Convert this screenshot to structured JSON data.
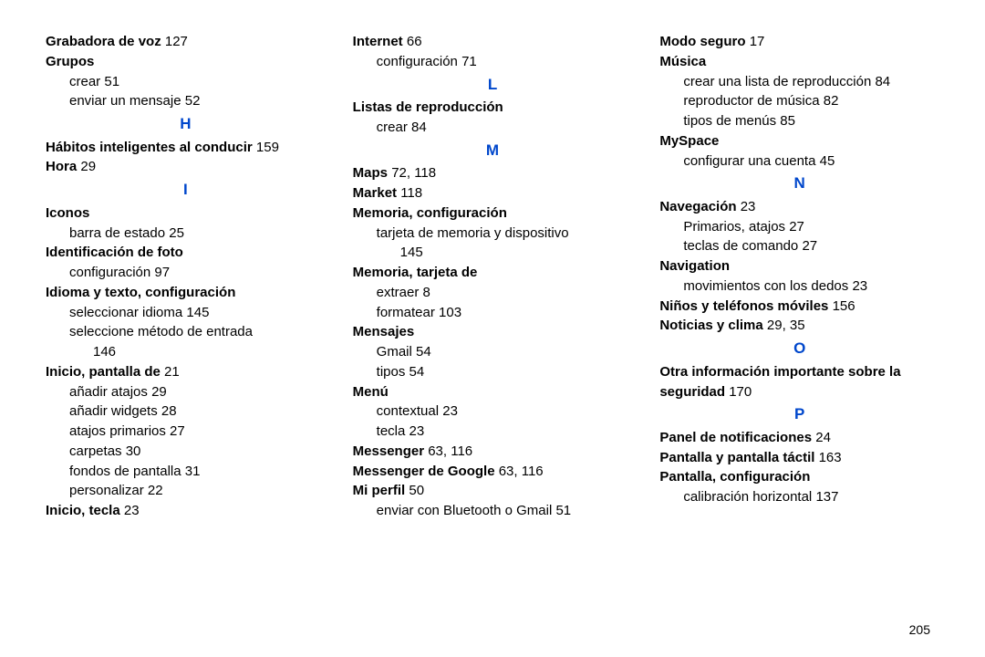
{
  "pageNumber": "205",
  "col1": {
    "grabadora": "Grabadora de voz",
    "grabadora_pg": "127",
    "grupos": "Grupos",
    "grupos_crear": "crear",
    "grupos_crear_pg": "51",
    "grupos_enviar": "enviar un mensaje",
    "grupos_enviar_pg": "52",
    "letter_H": "H",
    "habitos": "Hábitos inteligentes al conducir",
    "habitos_pg": "159",
    "hora": "Hora",
    "hora_pg": "29",
    "letter_I": "I",
    "iconos": "Iconos",
    "iconos_barra": "barra de estado",
    "iconos_barra_pg": "25",
    "ident_foto": "Identificación de foto",
    "ident_foto_cfg": "configuración",
    "ident_foto_cfg_pg": "97",
    "idioma": "Idioma y texto, configuración",
    "idioma_sel": "seleccionar idioma",
    "idioma_sel_pg": "145",
    "idioma_metodo": "seleccione método de entrada",
    "idioma_metodo_pg": "146",
    "inicio_pant": "Inicio, pantalla de",
    "inicio_pant_pg": "21",
    "inicio_atajos": "añadir atajos",
    "inicio_atajos_pg": "29",
    "inicio_widgets": "añadir widgets",
    "inicio_widgets_pg": "28",
    "inicio_prim": "atajos primarios",
    "inicio_prim_pg": "27",
    "inicio_carp": "carpetas",
    "inicio_carp_pg": "30",
    "inicio_fondos": "fondos de pantalla",
    "inicio_fondos_pg": "31",
    "inicio_pers": "personalizar",
    "inicio_pers_pg": "22",
    "inicio_tecla": "Inicio, tecla",
    "inicio_tecla_pg": "23"
  },
  "col2": {
    "internet": "Internet",
    "internet_pg": "66",
    "internet_cfg": "configuración",
    "internet_cfg_pg": "71",
    "letter_L": "L",
    "listas": "Listas de reproducción",
    "listas_crear": "crear",
    "listas_crear_pg": "84",
    "letter_M": "M",
    "maps": "Maps",
    "maps_pg": "72, 118",
    "market": "Market",
    "market_pg": "118",
    "mem_cfg": "Memoria, configuración",
    "mem_cfg_tarj": "tarjeta de memoria y dispositivo",
    "mem_cfg_tarj_pg": "145",
    "mem_tarj": "Memoria, tarjeta de",
    "mem_extraer": "extraer",
    "mem_extraer_pg": "8",
    "mem_format": "formatear",
    "mem_format_pg": "103",
    "mensajes": "Mensajes",
    "mensajes_gmail": "Gmail",
    "mensajes_gmail_pg": "54",
    "mensajes_tipos": "tipos",
    "mensajes_tipos_pg": "54",
    "menu": "Menú",
    "menu_ctx": "contextual",
    "menu_ctx_pg": "23",
    "menu_tecla": "tecla",
    "menu_tecla_pg": "23",
    "messenger": "Messenger",
    "messenger_pg": "63, 116",
    "messenger_g": "Messenger de Google",
    "messenger_g_pg": "63, 116",
    "miperfil": "Mi perfil",
    "miperfil_pg": "50",
    "miperfil_env": "enviar con Bluetooth o Gmail",
    "miperfil_env_pg": "51"
  },
  "col3": {
    "modoseg": "Modo seguro",
    "modoseg_pg": "17",
    "musica": "Música",
    "musica_lista": "crear una lista de reproducción",
    "musica_lista_pg": "84",
    "musica_rep": "reproductor de música",
    "musica_rep_pg": "82",
    "musica_tipos": "tipos de menús",
    "musica_tipos_pg": "85",
    "myspace": "MySpace",
    "myspace_cfg": "configurar una cuenta",
    "myspace_cfg_pg": "45",
    "letter_N": "N",
    "navegacion": "Navegación",
    "navegacion_pg": "23",
    "nav_prim": "Primarios, atajos",
    "nav_prim_pg": "27",
    "nav_teclas": "teclas de comando",
    "nav_teclas_pg": "27",
    "navigation": "Navigation",
    "navigation_mov": "movimientos con los dedos",
    "navigation_mov_pg": "23",
    "ninos": "Niños y teléfonos móviles",
    "ninos_pg": "156",
    "noticias": "Noticias y clima",
    "noticias_pg": "29, 35",
    "letter_O": "O",
    "otra": "Otra información importante sobre la seguridad",
    "otra_pg": "170",
    "letter_P": "P",
    "panel": "Panel de notificaciones",
    "panel_pg": "24",
    "pantalla_tact": "Pantalla y pantalla táctil",
    "pantalla_tact_pg": "163",
    "pantalla_cfg": "Pantalla, configuración",
    "pantalla_calib": "calibración horizontal",
    "pantalla_calib_pg": "137"
  }
}
